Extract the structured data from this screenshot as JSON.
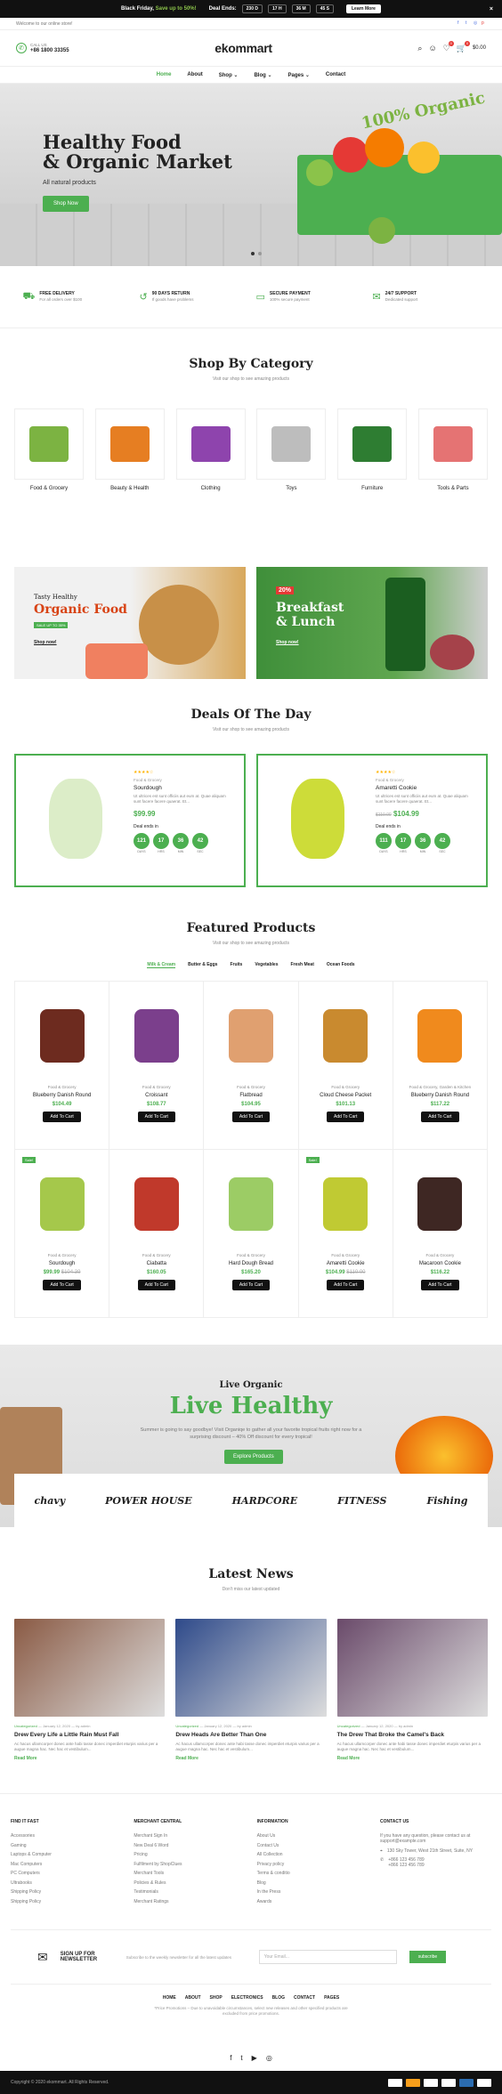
{
  "topbar": {
    "promo_a": "Black Friday,",
    "promo_b": "Save up to 50%!",
    "deal_label": "Deal Ends:",
    "countdown": [
      "230 D",
      "17 H",
      "36 M",
      "45 S"
    ],
    "learn_more": "Learn More",
    "close": "×"
  },
  "welcome": "Welcome to our online store!",
  "header": {
    "call_label": "CALL US",
    "phone": "+86 1800 33355",
    "logo": "ekommart",
    "wishlist_count": "0",
    "cart_count": "0",
    "cart_total": "$0.00"
  },
  "nav": [
    "Home",
    "About",
    "Shop",
    "Blog",
    "Pages",
    "Contact"
  ],
  "hero": {
    "title_line1": "Healthy Food",
    "title_line2": "& Organic Market",
    "subtitle": "All natural products",
    "button": "Shop Now",
    "badge": "100% Organic"
  },
  "features": [
    {
      "title": "FREE DELIVERY",
      "text": "For all orders over $100",
      "icon": "truck-icon"
    },
    {
      "title": "90 DAYS RETURN",
      "text": "If goods have problems",
      "icon": "return-icon"
    },
    {
      "title": "SECURE PAYMENT",
      "text": "100% secure payment",
      "icon": "card-icon"
    },
    {
      "title": "24/7 SUPPORT",
      "text": "Dedicated support",
      "icon": "chat-icon"
    }
  ],
  "categories": {
    "title": "Shop By Category",
    "subtitle": "Visit our shop to see amazing products",
    "items": [
      {
        "label": "Food & Grocery",
        "color": "#7cb342"
      },
      {
        "label": "Beauty & Health",
        "color": "#e67e22"
      },
      {
        "label": "Clothing",
        "color": "#8e44ad"
      },
      {
        "label": "Toys",
        "color": "#bdbdbd"
      },
      {
        "label": "Furniture",
        "color": "#2e7d32"
      },
      {
        "label": "Tools & Parts",
        "color": "#e57373"
      }
    ]
  },
  "promos": [
    {
      "kicker": "Tasty Healthy",
      "title": "Organic Food",
      "tag": "SALE UP TO 35%",
      "link": "Shop now!"
    },
    {
      "kicker": "20%",
      "title": "Breakfast & Lunch",
      "link": "Shop now!"
    }
  ],
  "deals": {
    "title": "Deals Of The Day",
    "subtitle": "Visit our shop to see amazing products",
    "items": [
      {
        "category": "Food & Grocery",
        "name": "Sourdough",
        "desc": "Ut ultrices est sunt officiis aut eum at. Quae aliquam sunt facere facere quaerat. Et...",
        "price": "$99.99",
        "old_price": "",
        "ends": "Deal ends in",
        "timer": [
          "121",
          "17",
          "36",
          "42"
        ],
        "units": [
          "DAYS",
          "HRS",
          "MIN",
          "SEC"
        ]
      },
      {
        "category": "Food & Grocery",
        "name": "Amaretti Cookie",
        "desc": "Ut ultrices est sunt officiis aut eum at. Quae aliquam sunt facere facere quaerat. Et...",
        "price": "$104.99",
        "old_price": "$110.00",
        "ends": "Deal ends in",
        "timer": [
          "111",
          "17",
          "36",
          "42"
        ],
        "units": [
          "DAYS",
          "HRS",
          "MIN",
          "SEC"
        ]
      }
    ]
  },
  "featured": {
    "title": "Featured Products",
    "subtitle": "Visit our shop to see amazing products",
    "tabs": [
      "Milk & Cream",
      "Butter & Eggs",
      "Fruits",
      "Vegetables",
      "Fresh Meat",
      "Ocean Foods"
    ],
    "add_to_cart": "Add To Cart",
    "sale_label": "Sale!",
    "products": [
      {
        "cat": "Food & Grocery",
        "name": "Blueberry Danish Round",
        "price": "$104.49",
        "old": "",
        "sale": false,
        "color": "#6d2b1f"
      },
      {
        "cat": "Food & Grocery",
        "name": "Croissant",
        "price": "$108.77",
        "old": "",
        "sale": false,
        "color": "#7b3f8c"
      },
      {
        "cat": "Food & Grocery",
        "name": "Flatbread",
        "price": "$104.95",
        "old": "",
        "sale": false,
        "color": "#e0a070"
      },
      {
        "cat": "Food & Grocery",
        "name": "Cloud Cheese Packet",
        "price": "$101.13",
        "old": "",
        "sale": false,
        "color": "#c98a2f"
      },
      {
        "cat": "Food & Grocery, Garden & Kitchen",
        "name": "Blueberry Danish Round",
        "price": "$117.22",
        "old": "",
        "sale": false,
        "color": "#f08a1d"
      },
      {
        "cat": "Food & Grocery",
        "name": "Sourdough",
        "price": "$99.99",
        "old": "$104.39",
        "sale": true,
        "color": "#a5c84b"
      },
      {
        "cat": "Food & Grocery",
        "name": "Ciabatta",
        "price": "$160.05",
        "old": "",
        "sale": false,
        "color": "#c0392b"
      },
      {
        "cat": "Food & Grocery",
        "name": "Hard Dough Bread",
        "price": "$165.20",
        "old": "",
        "sale": false,
        "color": "#9ccc65"
      },
      {
        "cat": "Food & Grocery",
        "name": "Amaretti Cookie",
        "price": "$104.99",
        "old": "$110.00",
        "sale": true,
        "color": "#c0ca33"
      },
      {
        "cat": "Food & Grocery",
        "name": "Macaroon Cookie",
        "price": "$116.22",
        "old": "",
        "sale": false,
        "color": "#3e2723"
      }
    ]
  },
  "live": {
    "kicker": "Live Organic",
    "title": "Live Healthy",
    "desc": "Summer is going to say goodbye! Visit Organiqe to gather all your favorite tropical fruits right now for a surprising discount – 40% Off discount for every tropical!",
    "button": "Explore Products",
    "brands": [
      "chavy",
      "POWER HOUSE",
      "HARDCORE",
      "FITNESS",
      "Fishing"
    ]
  },
  "news": {
    "title": "Latest News",
    "subtitle": "Don't miss our latest updated",
    "items": [
      {
        "tag": "Uncategorized",
        "date": "January 12, 2020",
        "author": "by admin",
        "title": "Drew Every Life a Little Rain Must Fall",
        "desc": "Ac hacus ullamcorper donec ante habi tasse donec imperdiet eturpis varius per a augue magna hac. Nec hac et vestibulum...",
        "more": "Read More",
        "color": "#8a5a44"
      },
      {
        "tag": "Uncategorized",
        "date": "January 12, 2020",
        "author": "by admin",
        "title": "Drew Heads Are Better Than One",
        "desc": "Ac hacus ullamcorper donec ante habi tasse donec imperdiet eturpis varius per a augue magna hac. Nec hac et vestibulum...",
        "more": "Read More",
        "color": "#2e4a8a"
      },
      {
        "tag": "Uncategorized",
        "date": "January 12, 2020",
        "author": "by admin",
        "title": "The Drew That Broke the Camel's Back",
        "desc": "Ac hacus ullamcorper donec ante habi tasse donec imperdiet eturpis varius per a augue magna hac. Nec hac et vestibulum...",
        "more": "Read More",
        "color": "#6a4a6a"
      }
    ]
  },
  "footer": {
    "cols": [
      {
        "title": "FIND IT FAST",
        "links": [
          "Accessories",
          "Gaming",
          "Laptops & Computer",
          "Mac Computers",
          "PC Computers",
          "Ultrabooks",
          "Shipping Policy",
          "Shipping Policy"
        ]
      },
      {
        "title": "MERCHANT CENTRAL",
        "links": [
          "Merchant Sign In",
          "New Deal 6 Word",
          "Pricing",
          "Fulfilment by ShopClues",
          "Merchant Tools",
          "Policies & Rules",
          "Testimonials",
          "Merchant Ratings"
        ]
      },
      {
        "title": "INFORMATION",
        "links": [
          "About Us",
          "Contact Us",
          "All Collection",
          "Privacy policy",
          "Terms & conditio",
          "Blog",
          "In the Press",
          "Awards"
        ]
      }
    ],
    "contact_title": "CONTACT US",
    "contact_text": "If you have any question, please contact us at support@example.com",
    "address": "130 Sky Tower, West 21th Street, Suite, NY",
    "phones": "+866 123 456 789\n+866 123 456 789",
    "newsletter_title": "SIGN UP FOR NEWSLETTER",
    "newsletter_desc": "Subscribe to the weekly newsletter for all the latest updates",
    "email_placeholder": "Your Email...",
    "subscribe": "subscribe",
    "links": [
      "HOME",
      "ABOUT",
      "SHOP",
      "ELECTRONICS",
      "BLOG",
      "CONTACT",
      "PAGES"
    ],
    "note": "*Price Promotions – Due to unavoidable circumstances, select new releases and other specified products are excluded from price promotions.",
    "copyright": "Copyright © 2020 ekommart. All Rights Reserved."
  }
}
